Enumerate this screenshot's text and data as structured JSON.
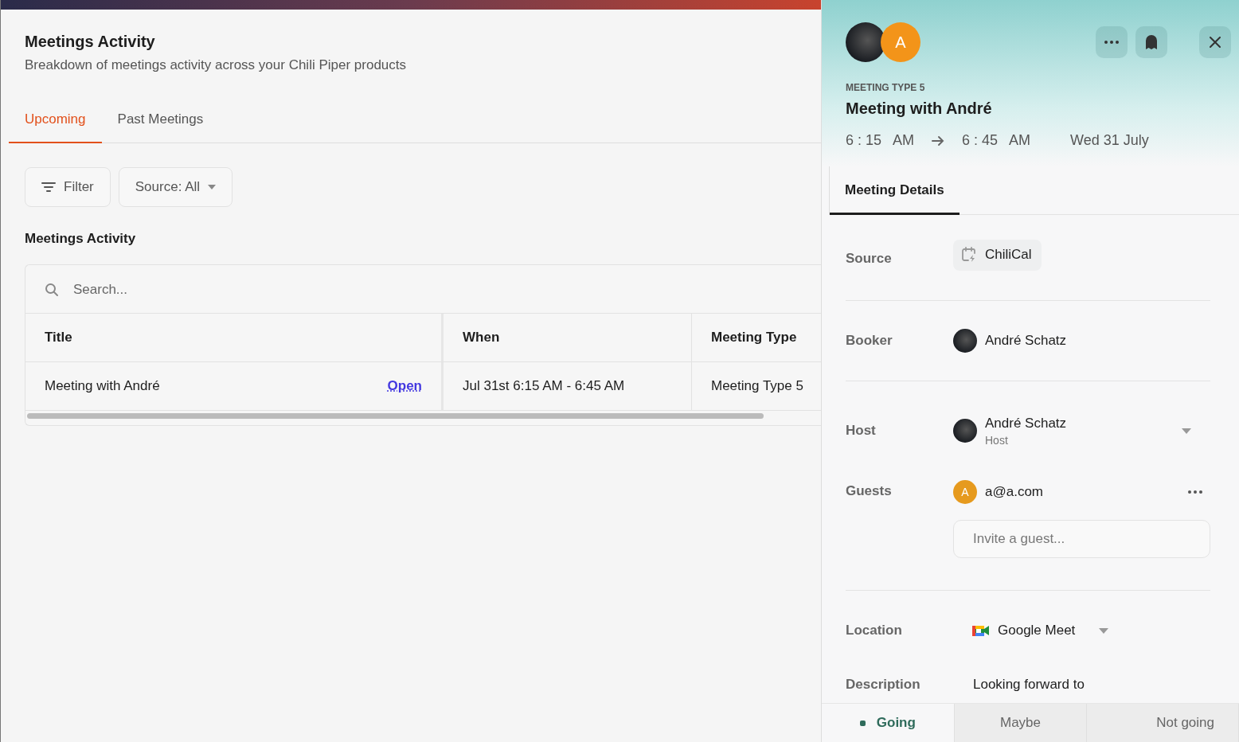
{
  "page": {
    "title": "Meetings Activity",
    "subtitle": "Breakdown of meetings activity across your Chili Piper products"
  },
  "tabs": [
    {
      "label": "Upcoming",
      "selected": true
    },
    {
      "label": "Past Meetings",
      "selected": false
    }
  ],
  "toolbar": {
    "filter": "Filter",
    "source": "Source: All"
  },
  "section_title": "Meetings Activity",
  "table": {
    "search_placeholder": "Search...",
    "columns": [
      "Title",
      "When",
      "Meeting Type"
    ],
    "rows": [
      {
        "title": "Meeting with André",
        "action": "Open",
        "when": "Jul 31st 6:15 AM - 6:45 AM",
        "meeting_type": "Meeting Type 5"
      }
    ]
  },
  "panel": {
    "guest_initial": "A",
    "meeting_type": "MEETING TYPE 5",
    "title": "Meeting with André",
    "start": "6 : 15   AM",
    "end": "6 : 45   AM",
    "date": "Wed 31 July",
    "tabs": [
      {
        "label": "Meeting Details",
        "selected": true
      }
    ],
    "source": {
      "label": "Source",
      "value": "ChiliCal"
    },
    "booker": {
      "label": "Booker",
      "name": "André Schatz"
    },
    "host": {
      "label": "Host",
      "name": "André Schatz",
      "role": "Host"
    },
    "guests": {
      "label": "Guests",
      "items": [
        {
          "initial": "A",
          "email": "a@a.com"
        }
      ],
      "invite_placeholder": "Invite a guest..."
    },
    "location": {
      "label": "Location",
      "value": "Google Meet"
    },
    "description": {
      "label": "Description",
      "value": "Looking forward to"
    },
    "rsvp": [
      {
        "label": "Going",
        "selected": true
      },
      {
        "label": "Maybe",
        "selected": false
      },
      {
        "label": "Not going",
        "selected": false
      }
    ]
  }
}
